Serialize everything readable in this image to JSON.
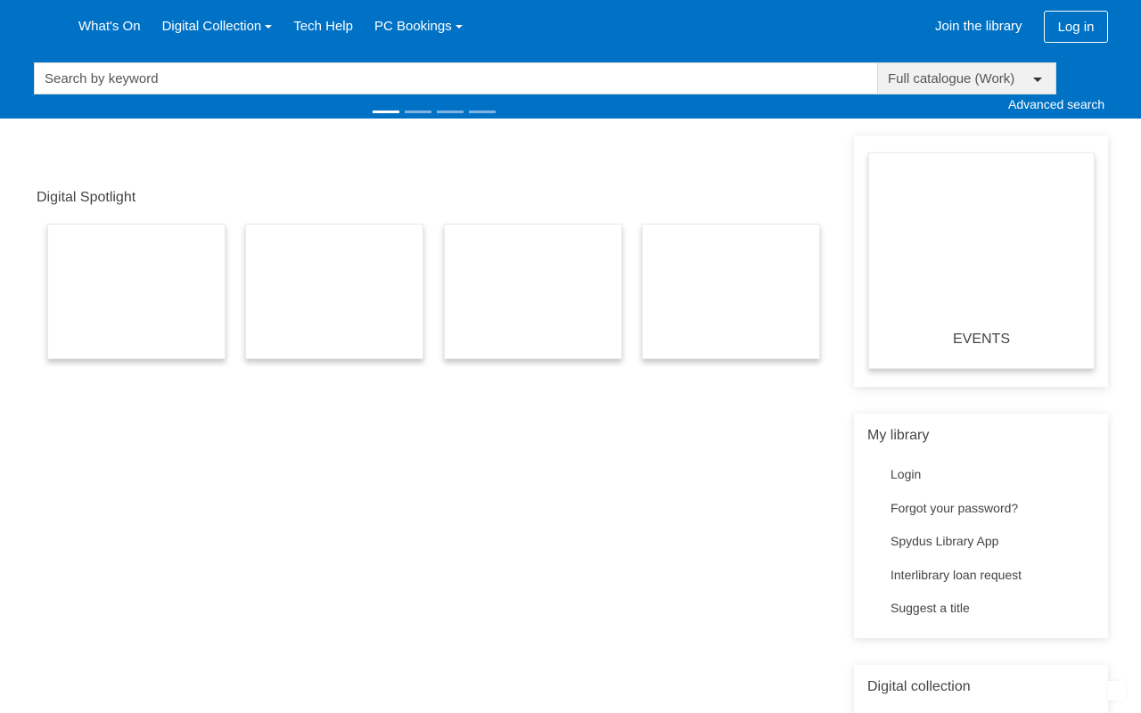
{
  "nav": {
    "items": [
      {
        "label": "What's On",
        "dropdown": false
      },
      {
        "label": "Digital Collection",
        "dropdown": true
      },
      {
        "label": "Tech Help",
        "dropdown": false
      },
      {
        "label": "PC Bookings",
        "dropdown": true
      }
    ],
    "join_label": "Join the library",
    "login_label": "Log in"
  },
  "search": {
    "placeholder": "Search by keyword",
    "scope_selected": "Full catalogue (Work)",
    "advanced_label": "Advanced search"
  },
  "carousel": {
    "slide_count": 4,
    "active_index": 0
  },
  "spotlight": {
    "title": "Digital Spotlight",
    "tile_count": 4
  },
  "sidebar": {
    "events_label": "EVENTS",
    "my_library": {
      "title": "My library",
      "links": [
        {
          "label": "Login"
        },
        {
          "label": "Forgot your password?"
        },
        {
          "label": "Spydus Library App"
        },
        {
          "label": "Interlibrary loan request"
        },
        {
          "label": "Suggest a title"
        }
      ]
    },
    "digital_collection": {
      "title": "Digital collection"
    }
  },
  "colors": {
    "header_bg": "#0072c6",
    "header_text": "#ffffff",
    "body_text": "#444444"
  }
}
